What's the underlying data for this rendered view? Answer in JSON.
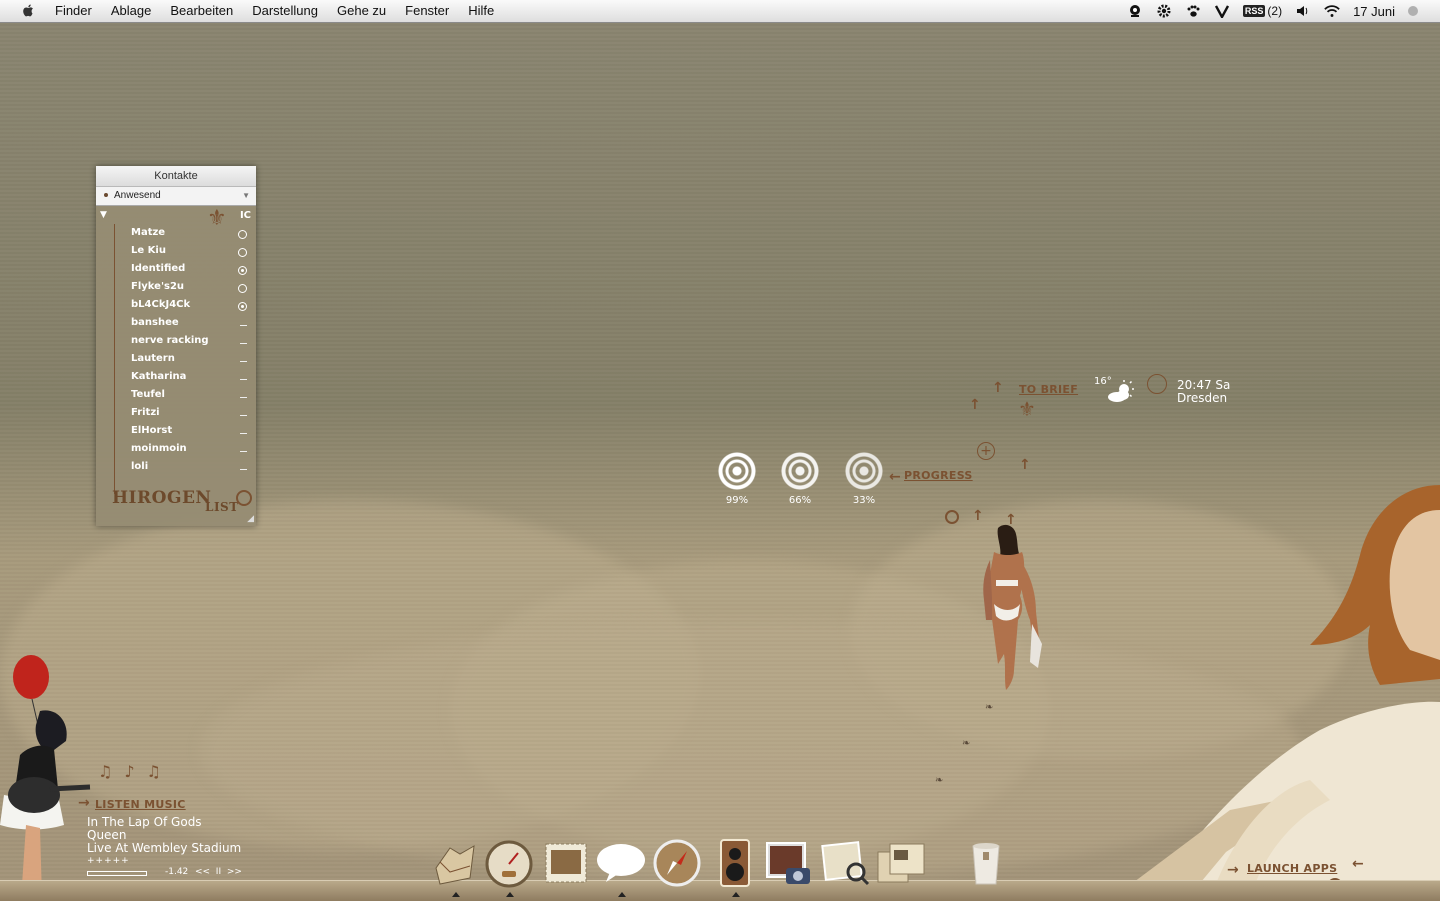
{
  "menubar": {
    "apple": "apple-menu",
    "menus": [
      "Finder",
      "Ablage",
      "Bearbeiten",
      "Darstellung",
      "Gehe zu",
      "Fenster",
      "Hilfe"
    ],
    "status": {
      "rss_label": "RSS",
      "rss_count": "(2)",
      "date": "17 Juni"
    }
  },
  "contacts": {
    "title": "Kontakte",
    "status": "Anwesend",
    "group_badge": "IC",
    "list": [
      {
        "name": "Matze",
        "state": "online"
      },
      {
        "name": "Le Kiu",
        "state": "online"
      },
      {
        "name": "Identified",
        "state": "idle"
      },
      {
        "name": "Flyke's2u",
        "state": "online"
      },
      {
        "name": "bL4CkJ4Ck",
        "state": "idle"
      },
      {
        "name": "banshee",
        "state": "offline"
      },
      {
        "name": "nerve racking",
        "state": "offline"
      },
      {
        "name": "Lautern",
        "state": "offline"
      },
      {
        "name": "Katharina",
        "state": "offline"
      },
      {
        "name": "Teufel",
        "state": "offline"
      },
      {
        "name": "Fritzi",
        "state": "offline"
      },
      {
        "name": "ElHorst",
        "state": "offline"
      },
      {
        "name": "moinmoin",
        "state": "offline"
      },
      {
        "name": "loli",
        "state": "offline"
      }
    ],
    "footer_main": "HIROGEN",
    "footer_sub": "LIST"
  },
  "progress": {
    "label": "PROGRESS",
    "items": [
      {
        "label": "99%",
        "value": 0.99
      },
      {
        "label": "66%",
        "value": 0.66
      },
      {
        "label": "33%",
        "value": 0.33
      }
    ]
  },
  "brief": {
    "label": "TO BRIEF"
  },
  "weather": {
    "temp": "16°",
    "icon": "partly-cloudy-icon"
  },
  "clock": {
    "time": "20:47 Sa",
    "city": "Dresden"
  },
  "music": {
    "label": "LISTEN MUSIC",
    "track": "In The Lap Of Gods",
    "artist": "Queen",
    "album": "Live At Wembley Stadium",
    "rating": "+++++",
    "remaining": "-1.42",
    "controls": "<<  II  >>"
  },
  "launch": {
    "label": "LAUNCH APPS"
  },
  "dock": [
    {
      "name": "finder-icon",
      "running": true
    },
    {
      "name": "dashboard-icon",
      "running": true
    },
    {
      "name": "mail-icon",
      "running": false
    },
    {
      "name": "ichat-icon",
      "running": true
    },
    {
      "name": "safari-icon",
      "running": false
    },
    {
      "name": "itunes-icon",
      "running": true
    },
    {
      "name": "iphoto-icon",
      "running": false
    },
    {
      "name": "preview-icon",
      "running": false
    },
    {
      "name": "documents-icon",
      "running": false
    },
    {
      "name": "trash-icon",
      "running": false
    }
  ],
  "colors": {
    "accent": "#7b5232",
    "desktop": "#858068",
    "text_light": "#ffffff"
  }
}
